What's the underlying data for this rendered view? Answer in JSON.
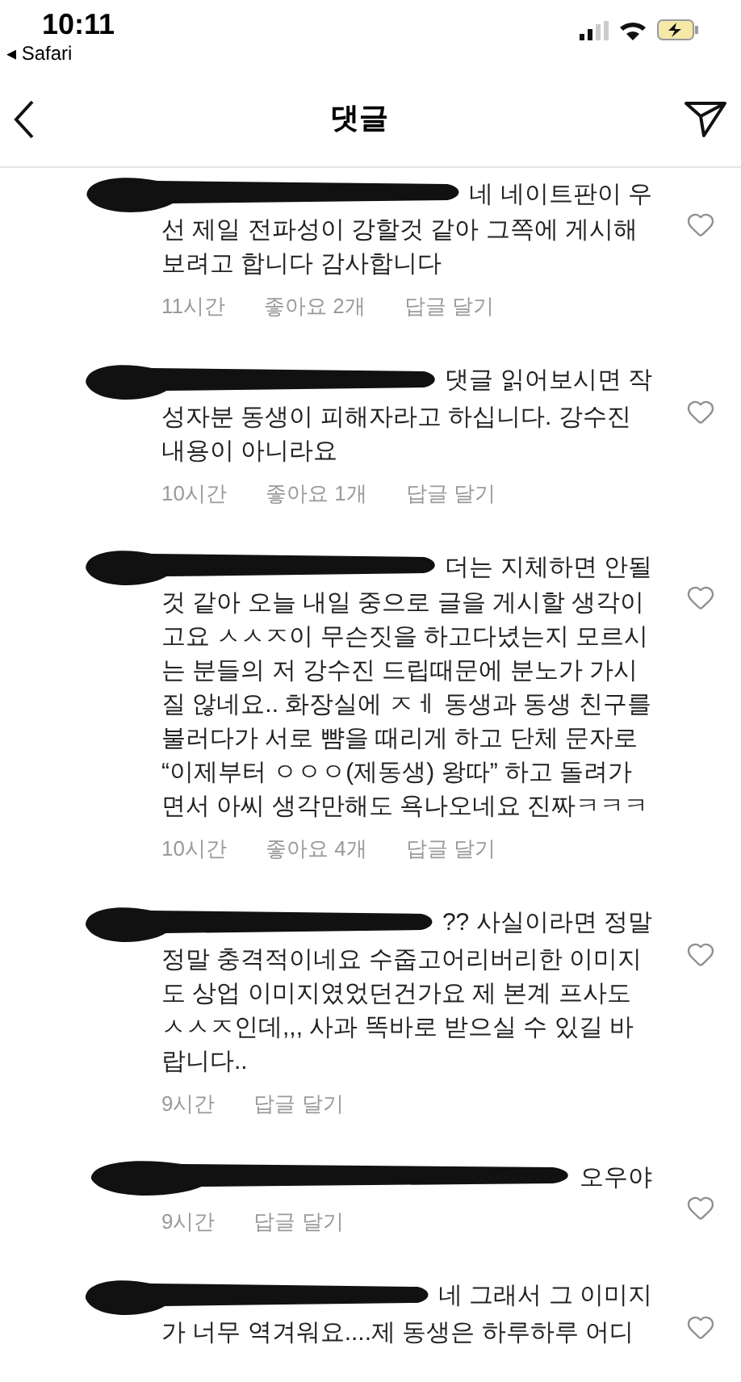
{
  "status_bar": {
    "time": "10:11",
    "back_app": "◂ Safari"
  },
  "header": {
    "title": "댓글"
  },
  "comments": [
    {
      "lines": [
        "네 네이트판이 우",
        "선 제일 전파성이 강할것 같아 그쪽에 게시해",
        "보려고 합니다 감사합니다"
      ],
      "time": "11시간",
      "likes": "좋아요 2개",
      "reply": "답글 달기",
      "liked": false
    },
    {
      "lines": [
        "댓글 읽어보시면 작",
        "성자분 동생이 피해자라고 하십니다. 강수진",
        "내용이 아니라요"
      ],
      "time": "10시간",
      "likes": "좋아요 1개",
      "reply": "답글 달기",
      "liked": false
    },
    {
      "lines": [
        "더는 지체하면 안될",
        "것 같아 오늘 내일 중으로 글을 게시할 생각이",
        "고요 ㅅㅅㅈ이 무슨짓을 하고다녔는지 모르시",
        "는 분들의 저 강수진 드립때문에 분노가 가시",
        "질 않네요.. 화장실에 ㅈㅔ 동생과 동생 친구를",
        "불러다가 서로 뺨을 때리게 하고 단체 문자로",
        "“이제부터 ㅇㅇㅇ(제동생) 왕따” 하고 돌려가",
        "면서 아씨 생각만해도 욕나오네요 진짜ㅋㅋㅋ"
      ],
      "time": "10시간",
      "likes": "좋아요 4개",
      "reply": "답글 달기",
      "liked": false
    },
    {
      "lines": [
        "?? 사실이라면 정말",
        "정말 충격적이네요 수줍고어리버리한 이미지",
        "도 상업 이미지였었던건가요 제 본계 프사도",
        "ㅅㅅㅈ인데,,, 사과 똑바로 받으실 수 있길 바",
        "랍니다.."
      ],
      "time": "9시간",
      "reply": "답글 달기",
      "liked": false
    },
    {
      "lines": [
        "오우야"
      ],
      "time": "9시간",
      "reply": "답글 달기",
      "liked": false
    },
    {
      "lines": [
        "네 그래서 그 이미지",
        "가 너무 역겨워요....제 동생은 하루하루 어디"
      ],
      "liked": false
    }
  ]
}
